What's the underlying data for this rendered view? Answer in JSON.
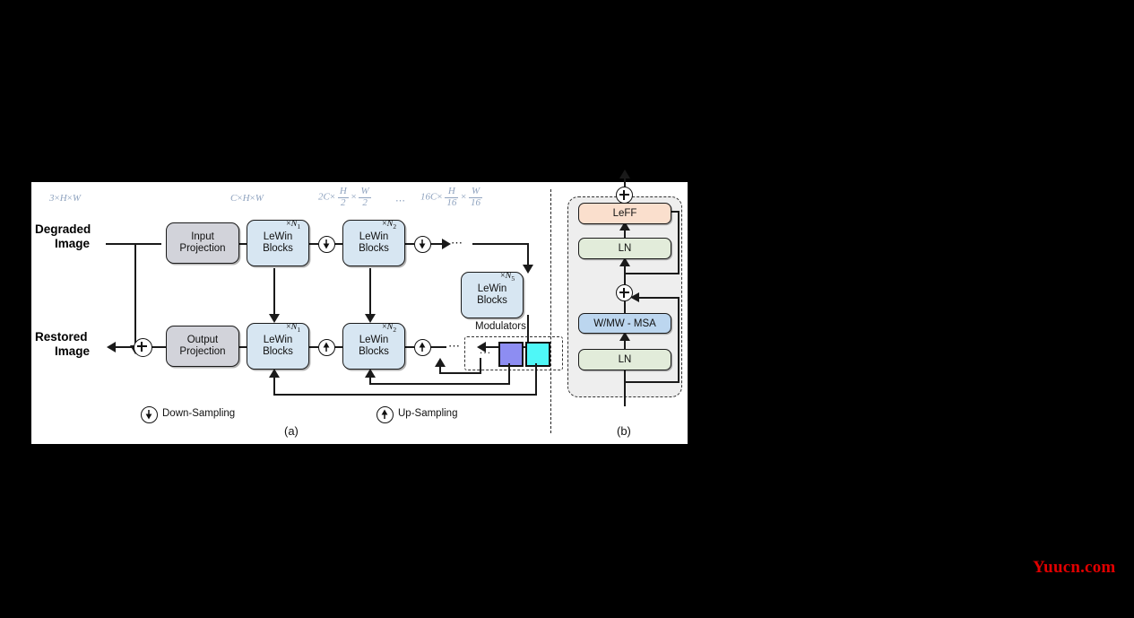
{
  "figure": {
    "panel_a": {
      "caption": "(a)",
      "dim_labels": [
        {
          "id": "d0",
          "text": "3×H×W"
        },
        {
          "id": "d1",
          "text": "C×H×W"
        },
        {
          "id": "d2",
          "text": "2C× H/2 × W/2"
        },
        {
          "id": "d3",
          "text": "16C× H/16 × W/16"
        },
        {
          "id": "d_ellipsis",
          "text": "⋯"
        }
      ],
      "io_labels": {
        "input": "Degraded\nImage",
        "input_line1": "Degraded",
        "input_line2": "Image",
        "output_line1": "Restored",
        "output_line2": "Image"
      },
      "blocks": [
        {
          "id": "input-projection",
          "label": "Input\nProjection",
          "line1": "Input",
          "line2": "Projection",
          "color": "#d2d3da"
        },
        {
          "id": "output-projection",
          "label": "Output\nProjection",
          "line1": "Output",
          "line2": "Projection",
          "color": "#d2d3da"
        },
        {
          "id": "encoder-lewin-1",
          "line1": "LeWin",
          "line2": "Blocks",
          "mult": "×N",
          "sub": "1",
          "color": "#d7e6f2"
        },
        {
          "id": "encoder-lewin-2",
          "line1": "LeWin",
          "line2": "Blocks",
          "mult": "×N",
          "sub": "2",
          "color": "#d7e6f2"
        },
        {
          "id": "bottleneck-lewin",
          "line1": "LeWin",
          "line2": "Blocks",
          "mult": "×N",
          "sub": "5",
          "color": "#d7e6f2"
        },
        {
          "id": "decoder-lewin-1",
          "line1": "LeWin",
          "line2": "Blocks",
          "mult": "×N",
          "sub": "1",
          "color": "#d7e6f2"
        },
        {
          "id": "decoder-lewin-2",
          "line1": "LeWin",
          "line2": "Blocks",
          "mult": "×N",
          "sub": "2",
          "color": "#d7e6f2"
        }
      ],
      "modulators": {
        "title": "Modulators",
        "ellipsis": "...",
        "swatches": [
          {
            "id": "modulator-1",
            "color": "#8d8df2"
          },
          {
            "id": "modulator-2",
            "color": "#4ff7f7"
          }
        ]
      },
      "legend": [
        {
          "id": "down-sampling",
          "label": "Down-Sampling",
          "icon": "arrow-down-circle-icon"
        },
        {
          "id": "up-sampling",
          "label": "Up-Sampling",
          "icon": "arrow-up-circle-icon"
        }
      ],
      "skip_ellipsis": "⋯"
    },
    "panel_b": {
      "caption": "(b)",
      "blocks": [
        {
          "id": "leff",
          "label": "LeFF",
          "color": "#fadfcd"
        },
        {
          "id": "ln-top",
          "label": "LN",
          "color": "#e2ecda"
        },
        {
          "id": "wmw-msa",
          "label": "W/MW - MSA",
          "color": "#bcd6ef"
        },
        {
          "id": "ln-bottom",
          "label": "LN",
          "color": "#e2ecda"
        }
      ],
      "adders": [
        "⊕",
        "⊕"
      ]
    }
  },
  "watermark": {
    "text": "Yuucn.com",
    "color": "#e10000"
  }
}
